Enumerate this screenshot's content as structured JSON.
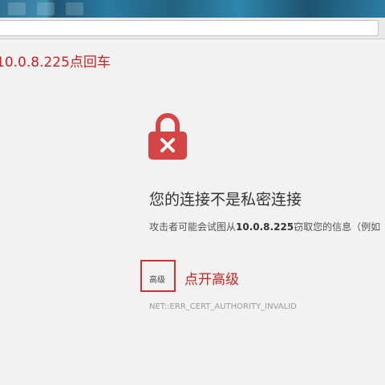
{
  "colors": {
    "annotation_red": "#cc2222",
    "lock_red": "#d64545",
    "background": "#f2f2f2",
    "title_text": "#333333"
  },
  "annotation_top": "10.0.8.225点回车",
  "annotation_advanced": "点开高级",
  "icons": {
    "lock": "padlock-with-x-icon"
  },
  "error_page": {
    "title": "您的连接不是私密连接",
    "description_prefix": "攻击者可能会试图从",
    "description_host": "10.0.8.225",
    "description_suffix": "窃取您的信息（例如",
    "advanced_button_label": "高级",
    "error_code": "NET::ERR_CERT_AUTHORITY_INVALID"
  }
}
